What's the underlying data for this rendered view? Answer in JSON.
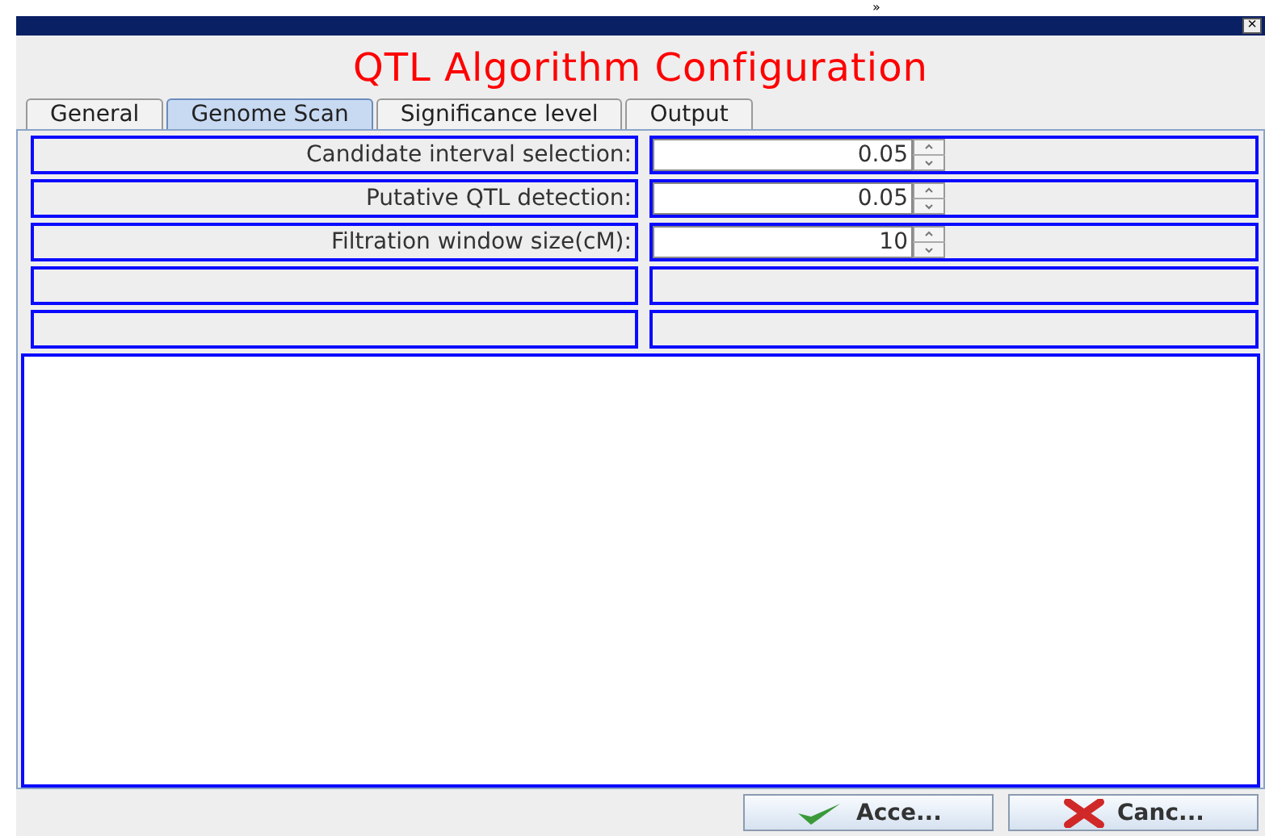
{
  "top_mark": "»",
  "window": {
    "title": "QTL Algorithm Configuration",
    "close": "×"
  },
  "tabs": [
    {
      "label": "General",
      "selected": false
    },
    {
      "label": "Genome Scan",
      "selected": true
    },
    {
      "label": "Significance level",
      "selected": false
    },
    {
      "label": "Output",
      "selected": false
    }
  ],
  "rows": [
    {
      "kind": "spinner",
      "label": "Candidate interval selection:",
      "value": "0.05"
    },
    {
      "kind": "spinner",
      "label": "Putative QTL detection:",
      "value": "0.05"
    },
    {
      "kind": "spinner",
      "label": "Filtration window size(cM):",
      "value": "10"
    },
    {
      "kind": "empty"
    },
    {
      "kind": "empty"
    }
  ],
  "buttons": [
    {
      "kind": "accept",
      "label": "Acce..."
    },
    {
      "kind": "cancel",
      "label": "Canc..."
    }
  ]
}
